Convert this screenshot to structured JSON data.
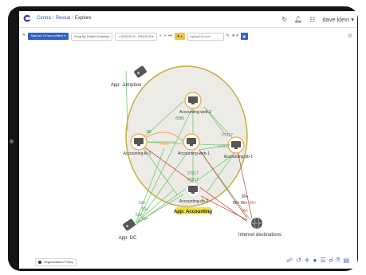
{
  "app": {
    "breadcrumbs": [
      "Centra",
      "Reveal",
      "Explore"
    ],
    "user": "dave.klein"
  },
  "toolbar": {
    "map_label": "Map Last 24 hours (offline)",
    "group_by_label": "Group By: Default Grouping",
    "date_range": "2019-02-24 - 2019-02-25",
    "search_placeholder": "Highlight by name"
  },
  "graph": {
    "group_label": "App: Accounting",
    "nodes": {
      "web2": "Accounting-web-2",
      "lb1": "Accounting-lb-1",
      "web1": "Accounting-web-1",
      "db1": "Accounting-db-1",
      "db2": "Accounting-db-2",
      "jumpbox": "App: Jumpbox",
      "dc": "App: DC",
      "internet": "Internet destinations"
    },
    "edge_labels": {
      "p8080a": "8080",
      "p80": "80",
      "p8080b": "8080",
      "p27017a": "27017",
      "p27017b": "27017",
      "p27017c": "27017",
      "p27017d": "27017",
      "p80red1": "80+",
      "p80red2": "80+",
      "p80red3": "80+",
      "p80red4": "80+",
      "p80red5": "80+",
      "p53a": "53+",
      "p53b": "53+",
      "p53c": "53+",
      "p53d": "53+"
    }
  },
  "bottom": {
    "policy_button": "Segmentation Policy"
  },
  "colors": {
    "accent": "#2f63c4",
    "group_fill": "#ecebe6",
    "group_border": "#c6a93a",
    "node_ring": "#f0a640",
    "edge_green": "#7cc47a",
    "edge_red": "#d05050",
    "label_highlight": "#f2e23a"
  },
  "icons": {
    "logo": "guardicore-logo-icon",
    "refresh": "refresh-icon",
    "bell": "notification-bell-icon",
    "settings": "settings-icon",
    "gear": "gear-icon"
  }
}
